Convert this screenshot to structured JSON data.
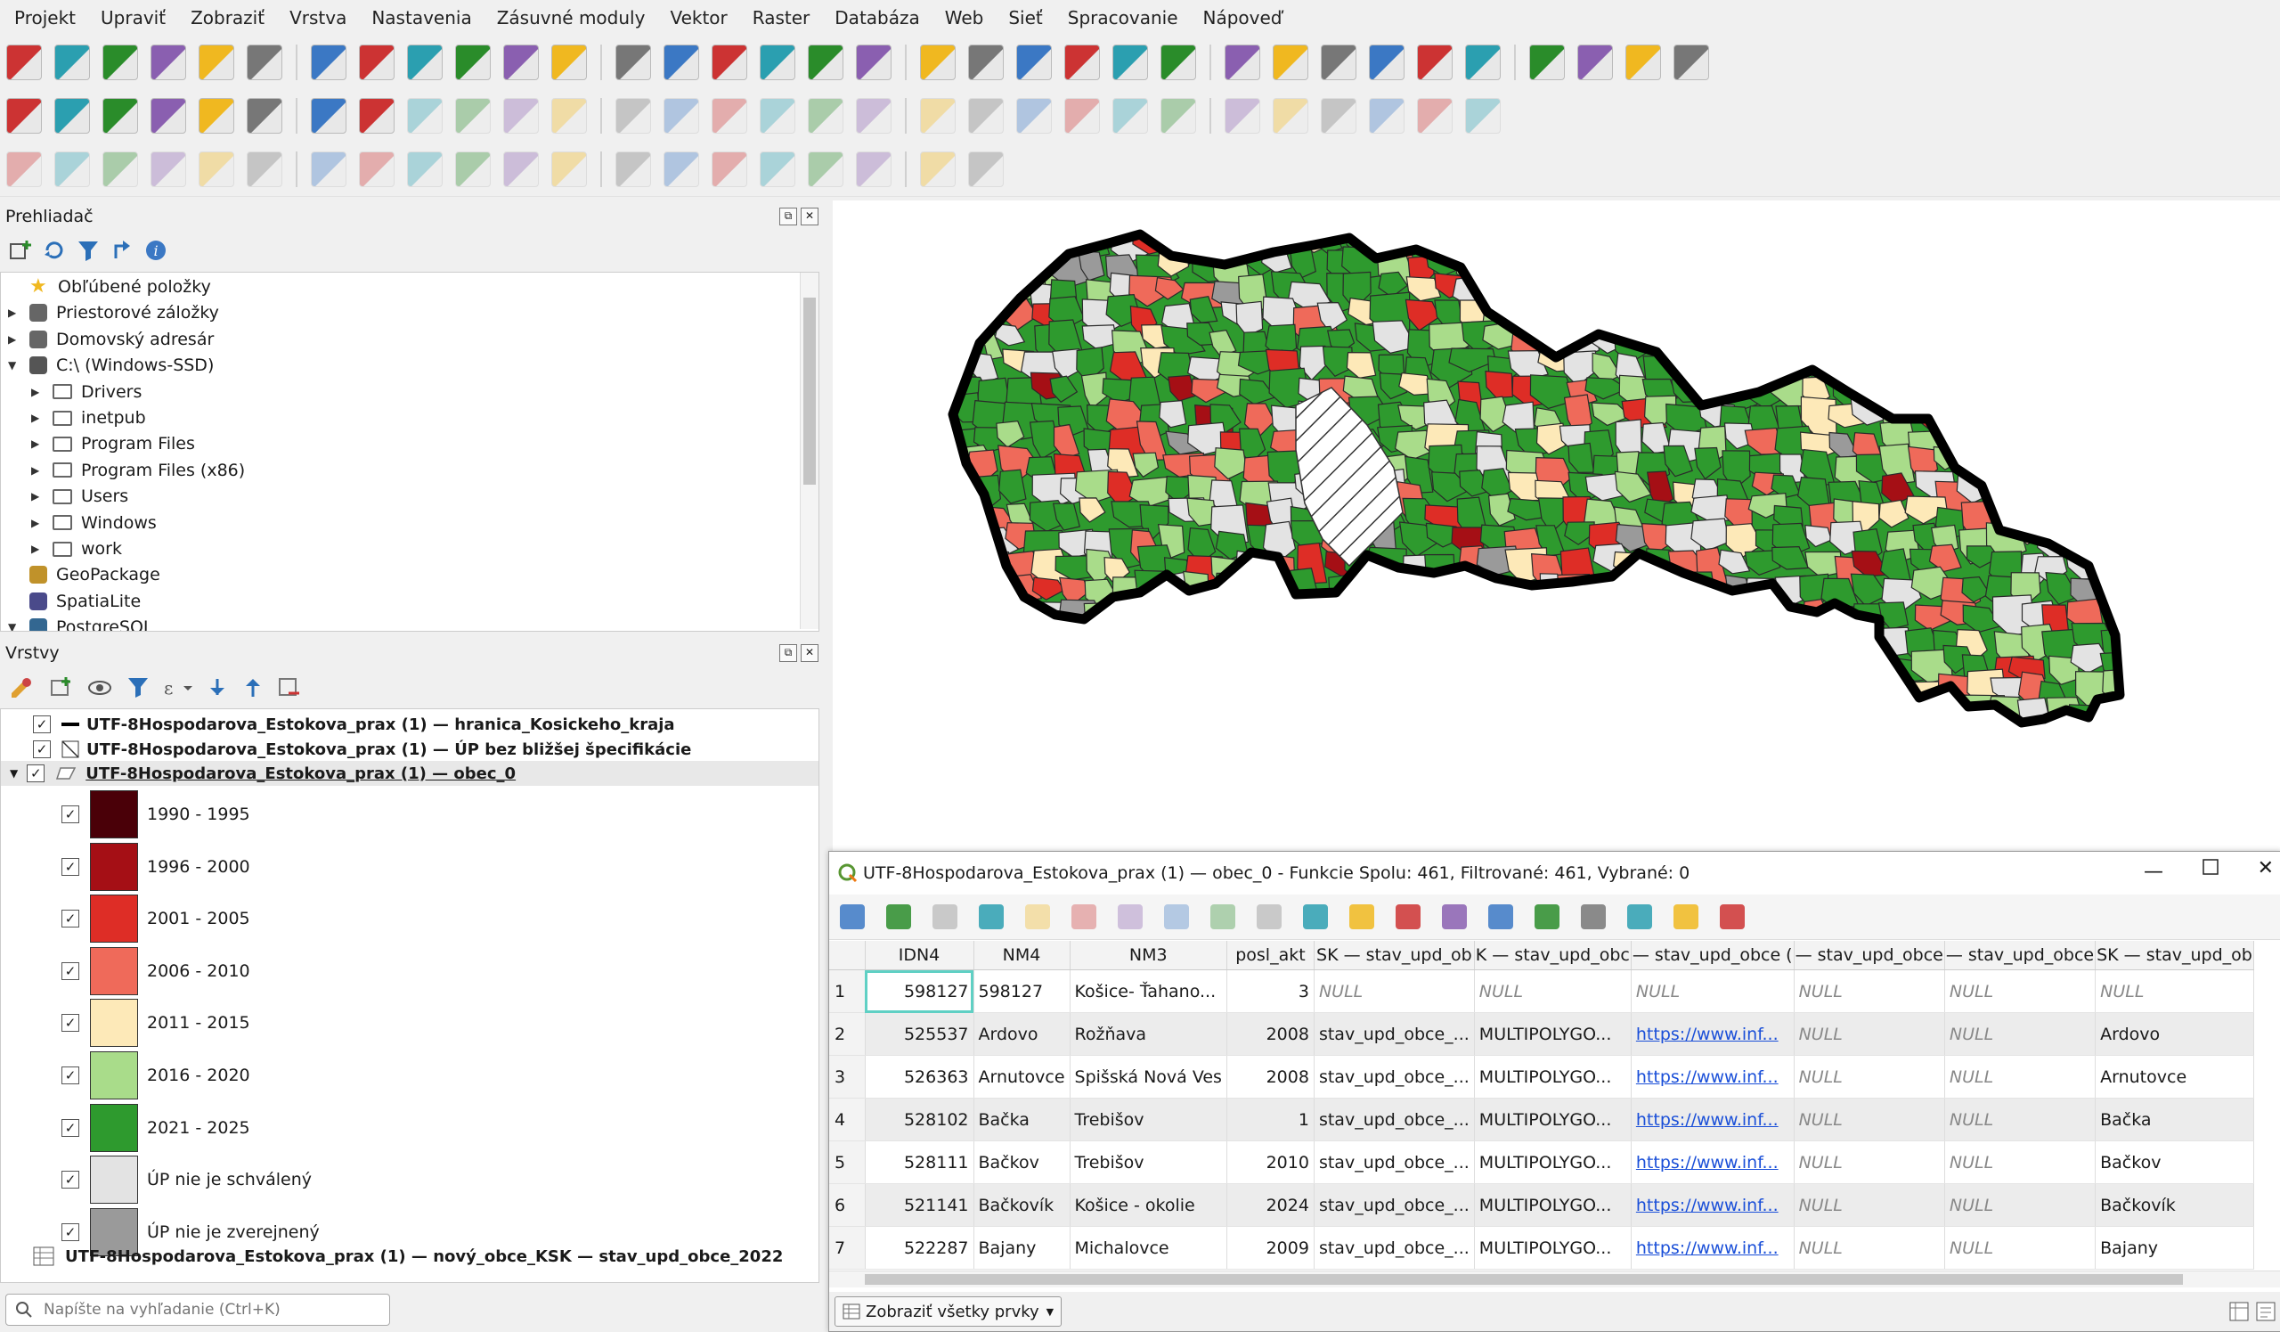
{
  "menu": [
    "Projekt",
    "Upraviť",
    "Zobraziť",
    "Vrstva",
    "Nastavenia",
    "Zásuvné moduly",
    "Vektor",
    "Raster",
    "Databáza",
    "Web",
    "Sieť",
    "Spracovanie",
    "Nápoveď"
  ],
  "browser": {
    "title": "Prehliadač",
    "items": [
      {
        "label": "Obľúbené položky",
        "icon": "star-icon",
        "level": 0,
        "expander": ""
      },
      {
        "label": "Priestorové záložky",
        "icon": "bookmark-icon",
        "level": 0,
        "expander": "▶"
      },
      {
        "label": "Domovský adresár",
        "icon": "home-icon",
        "level": 0,
        "expander": "▶"
      },
      {
        "label": "C:\\ (Windows-SSD)",
        "icon": "drive-icon",
        "level": 0,
        "expander": "▼"
      },
      {
        "label": "Drivers",
        "icon": "folder-icon",
        "level": 1,
        "expander": "▶"
      },
      {
        "label": "inetpub",
        "icon": "folder-icon",
        "level": 1,
        "expander": "▶"
      },
      {
        "label": "Program Files",
        "icon": "folder-icon",
        "level": 1,
        "expander": "▶"
      },
      {
        "label": "Program Files (x86)",
        "icon": "folder-icon",
        "level": 1,
        "expander": "▶"
      },
      {
        "label": "Users",
        "icon": "folder-icon",
        "level": 1,
        "expander": "▶"
      },
      {
        "label": "Windows",
        "icon": "folder-icon",
        "level": 1,
        "expander": "▶"
      },
      {
        "label": "work",
        "icon": "folder-icon",
        "level": 1,
        "expander": "▶"
      },
      {
        "label": "GeoPackage",
        "icon": "geopackage-icon",
        "level": 0,
        "expander": ""
      },
      {
        "label": "SpatiaLite",
        "icon": "spatialite-icon",
        "level": 0,
        "expander": ""
      },
      {
        "label": "PostgreSQL",
        "icon": "postgresql-icon",
        "level": 0,
        "expander": "▼"
      }
    ]
  },
  "layers": {
    "title": "Vrstvy",
    "items": [
      {
        "label": "UTF-8Hospodarova_Estokova_prax (1) — hranica_Kosickeho_kraja",
        "checked": true
      },
      {
        "label": "UTF-8Hospodarova_Estokova_prax (1) — ÚP bez bližšej špecifikácie",
        "checked": true
      },
      {
        "label": "UTF-8Hospodarova_Estokova_prax (1) — obec_0",
        "checked": true
      }
    ],
    "legend": [
      {
        "label": "1990 - 1995",
        "color": "#4a0008"
      },
      {
        "label": "1996 - 2000",
        "color": "#a50f15"
      },
      {
        "label": "2001 - 2005",
        "color": "#de2d26"
      },
      {
        "label": "2006 - 2010",
        "color": "#ef6a5a"
      },
      {
        "label": "2011 - 2015",
        "color": "#fde9b8"
      },
      {
        "label": "2016 - 2020",
        "color": "#a9dc8a"
      },
      {
        "label": "2021 - 2025",
        "color": "#2e9a2e"
      },
      {
        "label": "ÚP nie je schválený",
        "color": "#e3e3e3"
      },
      {
        "label": "ÚP nie je zverejnený",
        "color": "#9a9a9a"
      }
    ],
    "table_layer": "UTF-8Hospodarova_Estokova_prax (1) — nový_obce_KSK — stav_upd_obce_2022"
  },
  "search": {
    "placeholder": "Napíšte na vyhľadanie (Ctrl+K)"
  },
  "attr": {
    "title": "UTF-8Hospodarova_Estokova_prax (1) — obec_0 - Funkcie Spolu: 461, Filtrované: 461, Vybrané: 0",
    "columns": [
      "IDN4",
      "NM4",
      "NM3",
      "posl_akt",
      "SK — stav_upd_ob",
      "K — stav_upd_obc",
      "— stav_upd_obce (",
      "— stav_upd_obce",
      "— stav_upd_obce",
      "SK — stav_upd_ob"
    ],
    "rows": [
      [
        "1",
        "598127",
        "598127",
        "Košice- Ťahano...",
        "3",
        "NULL",
        "NULL",
        "NULL",
        "NULL",
        "NULL",
        "NULL"
      ],
      [
        "2",
        "525537",
        "Ardovo",
        "Rožňava",
        "2008",
        "stav_upd_obce_...",
        "MULTIPOLYGO...",
        "https://www.inf...",
        "NULL",
        "NULL",
        "Ardovo"
      ],
      [
        "3",
        "526363",
        "Arnutovce",
        "Spišská Nová Ves",
        "2008",
        "stav_upd_obce_...",
        "MULTIPOLYGO...",
        "https://www.inf...",
        "NULL",
        "NULL",
        "Arnutovce"
      ],
      [
        "4",
        "528102",
        "Bačka",
        "Trebišov",
        "1",
        "stav_upd_obce_...",
        "MULTIPOLYGO...",
        "https://www.inf...",
        "NULL",
        "NULL",
        "Bačka"
      ],
      [
        "5",
        "528111",
        "Bačkov",
        "Trebišov",
        "2010",
        "stav_upd_obce_...",
        "MULTIPOLYGO...",
        "https://www.inf...",
        "NULL",
        "NULL",
        "Bačkov"
      ],
      [
        "6",
        "521141",
        "Bačkovík",
        "Košice - okolie",
        "2024",
        "stav_upd_obce_...",
        "MULTIPOLYGO...",
        "https://www.inf...",
        "NULL",
        "NULL",
        "Bačkovík"
      ],
      [
        "7",
        "522287",
        "Bajany",
        "Michalovce",
        "2009",
        "stav_upd_obce_...",
        "MULTIPOLYGO...",
        "https://www.inf...",
        "NULL",
        "NULL",
        "Bajany"
      ]
    ],
    "show_all": "Zobraziť všetky prvky"
  }
}
